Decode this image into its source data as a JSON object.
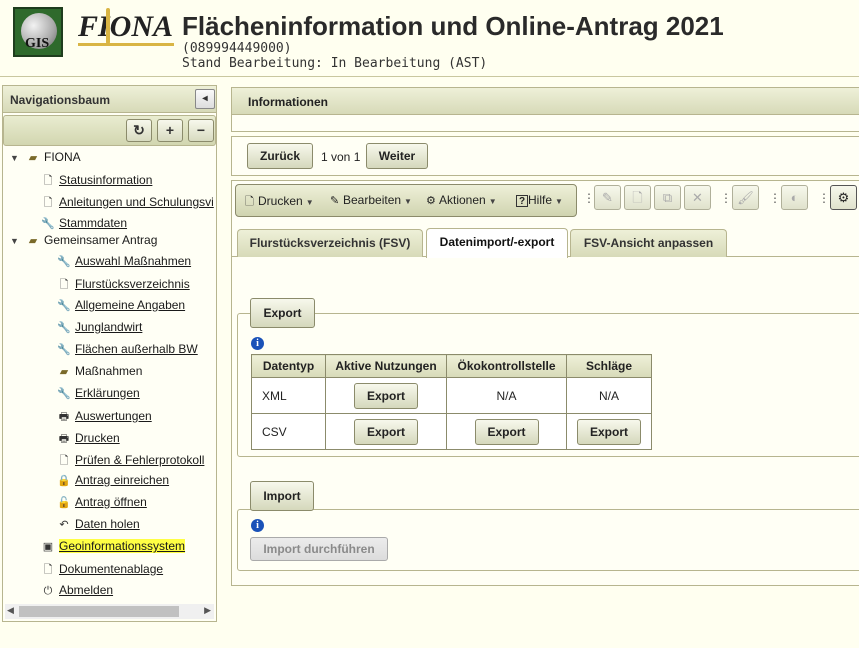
{
  "header": {
    "gis_logo_text": "GIS",
    "fiona_logo_text": "FIONA",
    "title": "Flächeninformation und Online-Antrag 2021",
    "id_line": "(089994449000)",
    "status_line": "Stand Bearbeitung: In Bearbeitung (AST)"
  },
  "nav": {
    "title": "Navigationsbaum",
    "collapse_glyph": "◂",
    "tools": {
      "refresh": "↻",
      "expand": "+",
      "collapse": "−"
    },
    "items": [
      {
        "label": "FIONA",
        "icon": "folder-open-icon",
        "glyph": "▰"
      },
      {
        "label": "Statusinformation",
        "icon": "page-icon",
        "glyph": "🗋"
      },
      {
        "label": "Anleitungen und Schulungsvi",
        "icon": "page-icon",
        "glyph": "🗋"
      },
      {
        "label": "Stammdaten",
        "icon": "wrench-icon",
        "glyph": "🔧"
      },
      {
        "label": "Gemeinsamer Antrag",
        "icon": "folder-open-icon",
        "glyph": "▰"
      },
      {
        "label": "Auswahl Maßnahmen",
        "icon": "wrench-icon",
        "glyph": "🔧"
      },
      {
        "label": "Flurstücksverzeichnis",
        "icon": "page-icon",
        "glyph": "🗋"
      },
      {
        "label": "Allgemeine Angaben",
        "icon": "wrench-icon",
        "glyph": "🔧"
      },
      {
        "label": "Junglandwirt",
        "icon": "wrench-icon",
        "glyph": "🔧"
      },
      {
        "label": "Flächen außerhalb BW",
        "icon": "wrench-icon",
        "glyph": "🔧"
      },
      {
        "label": "Maßnahmen",
        "icon": "folder-open-icon",
        "glyph": "▰"
      },
      {
        "label": "Erklärungen",
        "icon": "wrench-icon",
        "glyph": "🔧"
      },
      {
        "label": "Auswertungen",
        "icon": "printer-icon",
        "glyph": "🖶"
      },
      {
        "label": "Drucken",
        "icon": "printer-icon",
        "glyph": "🖶"
      },
      {
        "label": "Prüfen & Fehlerprotokoll",
        "icon": "page-icon",
        "glyph": "🗋"
      },
      {
        "label": "Antrag einreichen",
        "icon": "lock-icon",
        "glyph": "🔒"
      },
      {
        "label": "Antrag öffnen",
        "icon": "unlock-icon",
        "glyph": "🔓"
      },
      {
        "label": "Daten holen",
        "icon": "undo-icon",
        "glyph": "↶"
      },
      {
        "label": "Geoinformationssystem",
        "icon": "image-icon",
        "glyph": "▣"
      },
      {
        "label": "Dokumentenablage",
        "icon": "page-icon",
        "glyph": "🗋"
      },
      {
        "label": "Abmelden",
        "icon": "power-icon",
        "glyph": "⏻"
      }
    ]
  },
  "info": {
    "title": "Informationen"
  },
  "pager": {
    "back": "Zurück",
    "position": "1 von 1",
    "next": "Weiter"
  },
  "toolbar": {
    "print": "Drucken",
    "edit": "Bearbeiten",
    "actions": "Aktionen",
    "help": "Hilfe",
    "help_glyph": "?",
    "dropdown_glyph": "▼"
  },
  "tabs": [
    {
      "label": "Flurstücksverzeichnis (FSV)"
    },
    {
      "label": "Datenimport/-export"
    },
    {
      "label": "FSV-Ansicht anpassen"
    }
  ],
  "export": {
    "legend": "Export",
    "columns": [
      "Datentyp",
      "Aktive Nutzungen",
      "Ökokontrollstelle",
      "Schläge"
    ],
    "rows": [
      {
        "type": "XML",
        "aktive": "Export",
        "oeko": "N/A",
        "schlaege": "N/A"
      },
      {
        "type": "CSV",
        "aktive": "Export",
        "oeko": "Export",
        "schlaege": "Export"
      }
    ]
  },
  "import": {
    "legend": "Import",
    "button": "Import durchführen"
  },
  "info_glyph": "i",
  "colors": {
    "panel_header": "#d7dab8",
    "highlight": "#ffff44",
    "info_icon": "#1a52b8"
  }
}
